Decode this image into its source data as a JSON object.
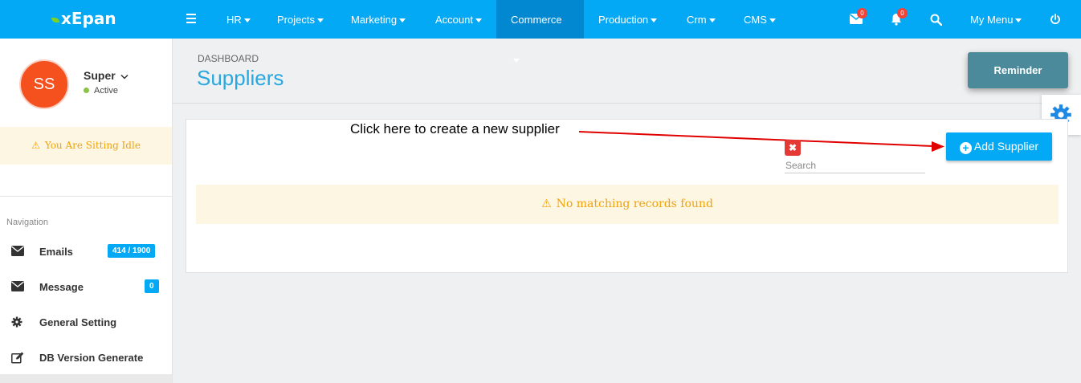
{
  "app": {
    "logo": "xEpan"
  },
  "topnav": {
    "items": [
      {
        "label": "HR"
      },
      {
        "label": "Projects"
      },
      {
        "label": "Marketing"
      },
      {
        "label": "Account"
      },
      {
        "label": "Commerce"
      },
      {
        "label": "Production"
      },
      {
        "label": "Crm"
      },
      {
        "label": "CMS"
      }
    ],
    "active": "Commerce",
    "mail_count": "0",
    "notif_count": "0",
    "my_menu": "My Menu"
  },
  "user": {
    "initials": "SS",
    "name": "Super",
    "status": "Active"
  },
  "idle_message": "You Are Sitting Idle",
  "sidebar": {
    "heading": "Navigation",
    "items": [
      {
        "label": "Emails",
        "badge": "414 / 1900",
        "icon": "envelope-icon"
      },
      {
        "label": "Message",
        "badge": "0",
        "icon": "envelope-icon"
      },
      {
        "label": "General Setting",
        "icon": "gear-icon"
      },
      {
        "label": "DB Version Generate",
        "icon": "edit-icon"
      }
    ]
  },
  "page": {
    "breadcrumb": "DASHBOARD",
    "title": "Suppliers"
  },
  "reminder_label": "Reminder",
  "annotation": "Click here to create a new supplier",
  "search": {
    "placeholder": "Search",
    "value": ""
  },
  "add_button": "Add Supplier",
  "empty_message": "No matching records found",
  "colors": {
    "primary": "#03a9f4",
    "active_nav": "#0288d1",
    "warning": "#f0a30a",
    "avatar": "#f4511e",
    "annotation_arrow": "#e00000"
  }
}
